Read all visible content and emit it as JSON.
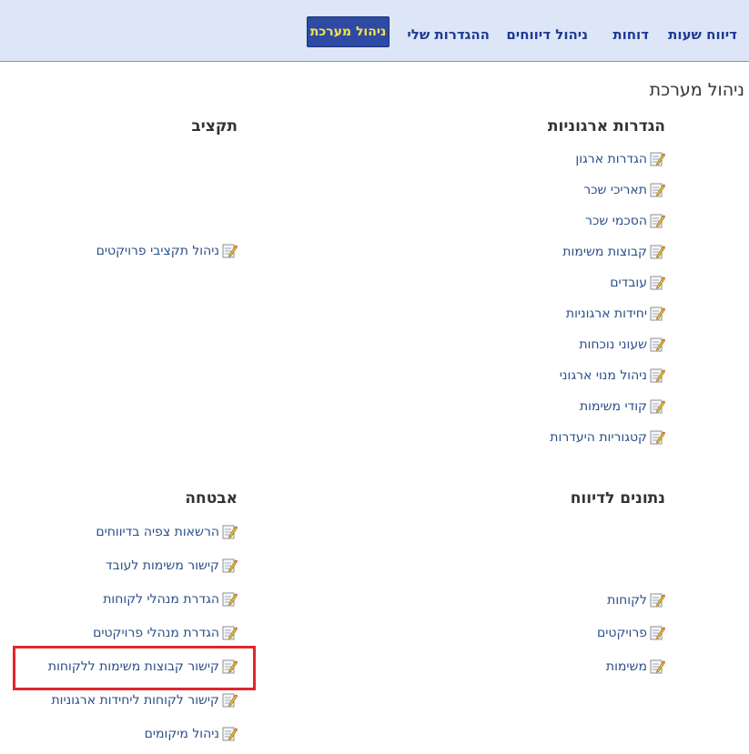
{
  "nav": {
    "hours_report": "דיווח שעות",
    "reports": "דוחות",
    "manage_reports": "ניהול דיווחים",
    "my_settings": "ההגדרות שלי",
    "system_admin": "ניהול מערכת"
  },
  "page": {
    "title": "ניהול מערכת"
  },
  "colors": {
    "nav_bg": "#dde6f7",
    "active_bg": "#2f4aa3",
    "active_text": "#f2e34b",
    "link": "#2a4f8a",
    "highlight": "#e0272d"
  },
  "sections": {
    "org_settings": {
      "title": "הגדרות ארגוניות",
      "items": [
        "הגדרות ארגון",
        "תאריכי שכר",
        "הסכמי שכר",
        "קבוצות משימות",
        "עובדים",
        "יחידות ארגוניות",
        "שעוני נוכחות",
        "ניהול מנוי ארגוני",
        "קודי משימות",
        "קטגוריות היעדרות"
      ]
    },
    "budget": {
      "title": "תקציב",
      "items": [
        "ניהול תקציבי פרויקטים"
      ]
    },
    "report_data": {
      "title": "נתונים לדיווח",
      "items": [
        "לקוחות",
        "פרויקטים",
        "משימות"
      ]
    },
    "security": {
      "title": "אבטחה",
      "items": [
        "הרשאות צפיה בדיווחים",
        "קישור משימות לעובד",
        "הגדרת מנהלי לקוחות",
        "הגדרת מנהלי פרויקטים",
        "קישור קבוצות משימות ללקוחות",
        "קישור לקוחות ליחידות ארגוניות",
        "ניהול מיקומים"
      ]
    }
  },
  "icon": "edit-document-icon"
}
